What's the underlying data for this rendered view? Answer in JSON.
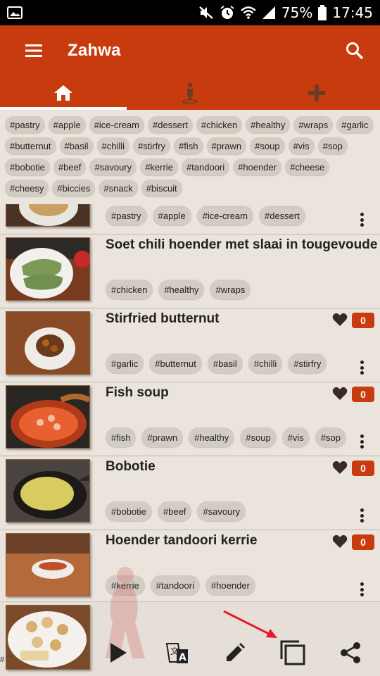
{
  "status": {
    "battery": "75%",
    "time": "17:45"
  },
  "app": {
    "title": "Zahwa"
  },
  "tabs": [
    {
      "name": "home",
      "icon": "home-icon"
    },
    {
      "name": "person",
      "icon": "person-icon"
    },
    {
      "name": "add",
      "icon": "plus-icon"
    }
  ],
  "tags": [
    "#pastry",
    "#apple",
    "#ice-cream",
    "#dessert",
    "#chicken",
    "#healthy",
    "#wraps",
    "#garlic",
    "#butternut",
    "#basil",
    "#chilli",
    "#stirfry",
    "#fish",
    "#prawn",
    "#soup",
    "#vis",
    "#sop",
    "#bobotie",
    "#beef",
    "#savoury",
    "#kerrie",
    "#tandoori",
    "#hoender",
    "#cheese",
    "#cheesy",
    "#biccies",
    "#snack",
    "#biscuit"
  ],
  "recipes": [
    {
      "title": "",
      "tags": [
        "#pastry",
        "#apple",
        "#ice-cream",
        "#dessert"
      ],
      "likes": ""
    },
    {
      "title": "Soet chili hoender met slaai in tougevoude brood",
      "tags": [
        "#chicken",
        "#healthy",
        "#wraps"
      ],
      "likes": ""
    },
    {
      "title": "Stirfried butternut",
      "tags": [
        "#garlic",
        "#butternut",
        "#basil",
        "#chilli",
        "#stirfry"
      ],
      "likes": "0"
    },
    {
      "title": "Fish soup",
      "tags": [
        "#fish",
        "#prawn",
        "#healthy",
        "#soup",
        "#vis",
        "#sop"
      ],
      "likes": "0"
    },
    {
      "title": "Bobotie",
      "tags": [
        "#bobotie",
        "#beef",
        "#savoury"
      ],
      "likes": "0"
    },
    {
      "title": "Hoender tandoori kerrie",
      "tags": [
        "#kerrie",
        "#tandoori",
        "#hoender"
      ],
      "likes": "0"
    }
  ],
  "bottom": {
    "left_text": "#"
  },
  "colors": {
    "primary": "#c73b0f",
    "background": "#eae4dc",
    "chip": "#d3ccc3",
    "annotation_arrow": "#e8192c"
  }
}
